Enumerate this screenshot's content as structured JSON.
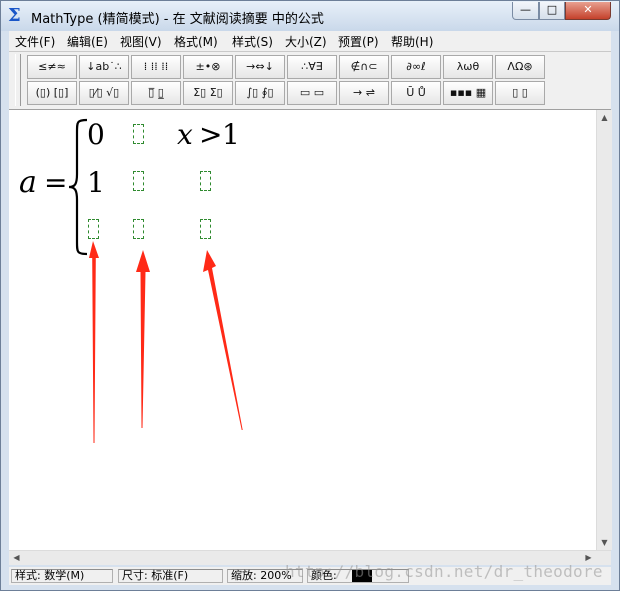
{
  "window": {
    "title": "MathType (精简模式) - 在 文献阅读摘要 中的公式",
    "app_icon": "sigma-icon",
    "controls": {
      "minimize": "—",
      "maximize": "□",
      "close": "✕"
    }
  },
  "menu": [
    "文件(F)",
    "编辑(E)",
    "视图(V)",
    "格式(M)",
    "样式(S)",
    "大小(Z)",
    "预置(P)",
    "帮助(H)"
  ],
  "palettes": {
    "row1": [
      "≤≠≈",
      "↓ab˙∴",
      "⁞ ⁞⁞ ⁞⁞",
      "±•⊗",
      "→⇔↓",
      "∴∀∃",
      "∉∩⊂",
      "∂∞ℓ",
      "λωθ",
      "ΛΩ⊛"
    ],
    "row2": [
      "(▯) [▯]",
      "▯⁄▯ √▯",
      "▯̅ ▯̲",
      "Σ▯ Σ▯",
      "∫▯ ∮▯",
      "▭ ▭",
      "→ ⇌",
      "Ū Ů",
      "▪▪▪ ▦",
      "▯ ▯"
    ]
  },
  "equation": {
    "lhs_var": "a",
    "equals": "=",
    "brace": "{",
    "row1": {
      "col1": "0",
      "col3_var": "x",
      "col3_op": ">",
      "col3_num": "1"
    },
    "row2": {
      "col1": "1"
    }
  },
  "status": {
    "style": "样式: 数学(M)",
    "size": "尺寸: 标准(F)",
    "zoom": "缩放: 200%",
    "color": "颜色:"
  },
  "watermark": "http://blog.csdn.net/dr_theodore",
  "colors": {
    "arrow": "#ff2a17",
    "placeholder": "#2f8a2f",
    "close_button": "#c4412b"
  }
}
